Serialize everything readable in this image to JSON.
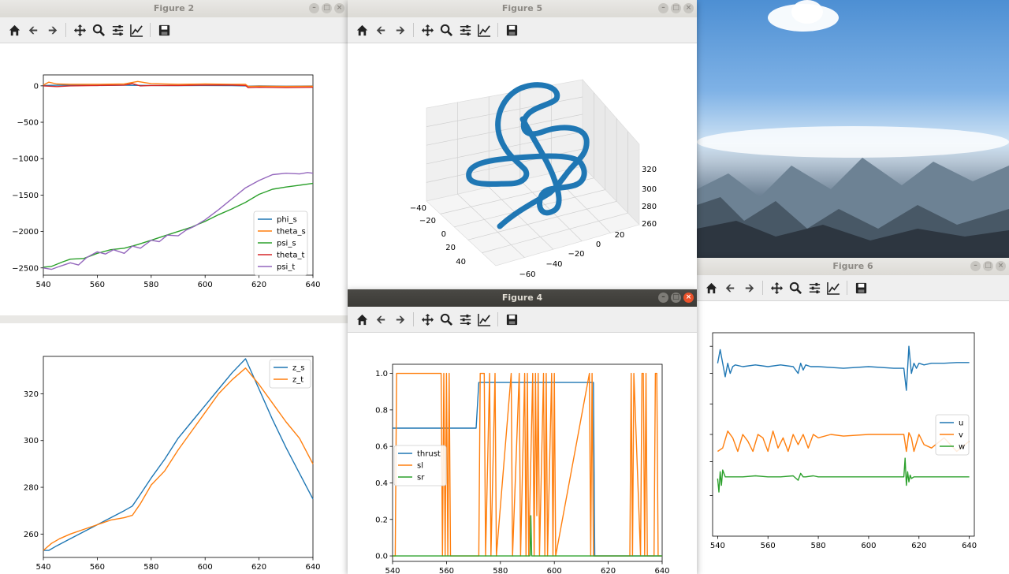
{
  "windows": {
    "fig2": {
      "title": "Figure 2"
    },
    "fig5": {
      "title": "Figure 5"
    },
    "fig4": {
      "title": "Figure 4"
    },
    "fig6": {
      "title": "Figure 6"
    }
  },
  "toolbar_icons": [
    "home-icon",
    "back-icon",
    "forward-icon",
    "pan-icon",
    "zoom-icon",
    "configure-subplots-icon",
    "edit-axis-icon",
    "save-icon"
  ],
  "colors": {
    "c0": "#1f77b4",
    "c1": "#ff7f0e",
    "c2": "#2ca02c",
    "c3": "#d62728",
    "c4": "#9467bd"
  },
  "chart_data": [
    {
      "id": "fig2-angles",
      "type": "line",
      "xlim": [
        540,
        640
      ],
      "ylim": [
        -2600,
        150
      ],
      "xticks": [
        "540",
        "560",
        "580",
        "600",
        "620",
        "640"
      ],
      "yticks": [
        "0",
        "−500",
        "−1000",
        "−1500",
        "−2000",
        "−2500"
      ],
      "legend_position": "lower-right",
      "series": [
        {
          "name": "phi_s",
          "color": "#1f77b4",
          "x": [
            540,
            545,
            550,
            560,
            570,
            580,
            590,
            600,
            610,
            615,
            615.5,
            620,
            630,
            640
          ],
          "y": [
            5,
            8,
            10,
            5,
            8,
            5,
            3,
            5,
            3,
            0,
            -5,
            -2,
            -5,
            -3
          ]
        },
        {
          "name": "theta_s",
          "color": "#ff7f0e",
          "x": [
            540,
            542,
            545,
            550,
            560,
            570,
            575,
            580,
            590,
            600,
            610,
            615,
            616,
            620,
            630,
            640
          ],
          "y": [
            10,
            50,
            25,
            20,
            20,
            25,
            60,
            30,
            20,
            25,
            20,
            20,
            -8,
            -5,
            -8,
            -5
          ]
        },
        {
          "name": "psi_s",
          "color": "#2ca02c",
          "x": [
            540,
            543,
            547,
            550,
            555,
            560,
            565,
            570,
            575,
            580,
            585,
            590,
            595,
            600,
            605,
            610,
            615,
            620,
            625,
            630,
            635,
            640
          ],
          "y": [
            -2490,
            -2480,
            -2420,
            -2380,
            -2370,
            -2300,
            -2250,
            -2230,
            -2180,
            -2120,
            -2060,
            -2000,
            -1940,
            -1860,
            -1770,
            -1690,
            -1600,
            -1490,
            -1420,
            -1390,
            -1365,
            -1340
          ]
        },
        {
          "name": "theta_t",
          "color": "#d62728",
          "x": [
            540,
            545,
            550,
            560,
            570,
            573,
            576,
            580,
            590,
            600,
            610,
            615,
            616,
            620,
            630,
            640
          ],
          "y": [
            0,
            -10,
            0,
            5,
            10,
            30,
            0,
            5,
            5,
            10,
            10,
            5,
            -25,
            -20,
            -25,
            -20
          ]
        },
        {
          "name": "psi_t",
          "color": "#9467bd",
          "x": [
            540,
            543,
            546,
            550,
            553,
            556,
            560,
            563,
            566,
            570,
            573,
            576,
            580,
            583,
            586,
            590,
            593,
            596,
            600,
            605,
            610,
            615,
            620,
            625,
            630,
            635,
            638,
            640
          ],
          "y": [
            -2500,
            -2520,
            -2480,
            -2430,
            -2460,
            -2360,
            -2280,
            -2310,
            -2250,
            -2300,
            -2200,
            -2230,
            -2120,
            -2140,
            -2050,
            -2060,
            -1980,
            -1930,
            -1840,
            -1700,
            -1550,
            -1400,
            -1300,
            -1220,
            -1200,
            -1210,
            -1190,
            -1200
          ]
        }
      ]
    },
    {
      "id": "fig2-z",
      "type": "line",
      "xlim": [
        540,
        640
      ],
      "ylim": [
        250,
        336
      ],
      "xticks": [
        "540",
        "560",
        "580",
        "600",
        "620",
        "640"
      ],
      "yticks": [
        "260",
        "280",
        "300",
        "320"
      ],
      "legend_position": "upper-right",
      "series": [
        {
          "name": "z_s",
          "color": "#1f77b4",
          "x": [
            540,
            542,
            545,
            550,
            555,
            560,
            565,
            570,
            573,
            576,
            580,
            585,
            590,
            595,
            600,
            605,
            610,
            615,
            620,
            625,
            630,
            635,
            640
          ],
          "y": [
            253,
            253,
            255,
            258,
            261,
            264,
            267,
            270,
            272,
            277,
            284,
            292,
            301,
            308,
            315,
            322,
            329,
            335,
            322,
            309,
            297,
            286,
            275
          ]
        },
        {
          "name": "z_t",
          "color": "#ff7f0e",
          "x": [
            540,
            543,
            546,
            550,
            555,
            560,
            565,
            570,
            573,
            576,
            580,
            585,
            590,
            595,
            600,
            605,
            610,
            615,
            620,
            625,
            630,
            635,
            640
          ],
          "y": [
            253,
            256,
            258,
            260,
            262,
            264,
            266,
            267,
            268,
            273,
            281,
            287,
            296,
            304,
            312,
            320,
            326,
            331,
            324,
            316,
            308,
            301,
            290
          ]
        }
      ]
    },
    {
      "id": "fig5-3d",
      "type": "scatter",
      "axis_ticks": {
        "x": [
          "−40",
          "−20",
          "0",
          "20",
          "40"
        ],
        "y": [
          "−60",
          "−40",
          "−20",
          "0",
          "20"
        ],
        "z": [
          "260",
          "280",
          "300",
          "320"
        ]
      },
      "series": [
        {
          "color": "#1f77b4"
        }
      ]
    },
    {
      "id": "fig4-controls",
      "type": "line",
      "xlim": [
        540,
        640
      ],
      "ylim": [
        -0.03,
        1.05
      ],
      "xticks": [
        "540",
        "560",
        "580",
        "600",
        "620",
        "640"
      ],
      "yticks": [
        "0.0",
        "0.2",
        "0.4",
        "0.6",
        "0.8",
        "1.0"
      ],
      "legend_position": "center-left",
      "series": [
        {
          "name": "thrust",
          "color": "#1f77b4",
          "x": [
            540,
            571,
            572,
            614.5,
            615,
            640
          ],
          "y": [
            0.7,
            0.7,
            0.95,
            0.95,
            0,
            0
          ]
        },
        {
          "name": "sl",
          "color": "#ff7f0e",
          "x": [
            540,
            541,
            541.5,
            558,
            558.5,
            559,
            559.5,
            560,
            560.5,
            561,
            561.5,
            572,
            572.5,
            574,
            574.5,
            576,
            576.5,
            578,
            578.5,
            584,
            584.5,
            587,
            587.5,
            589,
            589.5,
            590,
            590.5,
            592,
            592.5,
            593,
            593.5,
            594,
            594.5,
            596,
            596.5,
            597,
            597.5,
            599,
            599.5,
            600,
            600.5,
            613,
            613.5,
            614,
            614.5,
            628,
            628.5,
            629,
            629.5,
            632,
            632.5,
            633,
            633.5,
            634,
            634.5,
            637,
            637.5,
            638,
            638.5,
            640
          ],
          "y": [
            0,
            0,
            1,
            1,
            0,
            1,
            0,
            1,
            0,
            1,
            0,
            0,
            1,
            1,
            0,
            1,
            0,
            1,
            0,
            1,
            0,
            1,
            0,
            1,
            0,
            1,
            0,
            1,
            0,
            1,
            0.22,
            1,
            0,
            1,
            0,
            1,
            0,
            1,
            0,
            1,
            0,
            1,
            0,
            1,
            0,
            0,
            1,
            0,
            1,
            0,
            1,
            1,
            0,
            1,
            0,
            0,
            1,
            1,
            0,
            0
          ]
        },
        {
          "name": "sr",
          "color": "#2ca02c",
          "x": [
            540,
            591,
            591.3,
            591.6,
            592,
            640
          ],
          "y": [
            0,
            0,
            0.22,
            0.0,
            0,
            0
          ]
        }
      ]
    },
    {
      "id": "fig6-velocities",
      "type": "line",
      "xlim": [
        538,
        642
      ],
      "ylim": [
        -4.5,
        1.5
      ],
      "xticks": [
        "540",
        "560",
        "580",
        "600",
        "620",
        "640"
      ],
      "legend_position": "center-right",
      "series": [
        {
          "name": "u",
          "color": "#1f77b4",
          "x": [
            540,
            541,
            542,
            543,
            544,
            545,
            546,
            547,
            550,
            555,
            560,
            565,
            570,
            572,
            573,
            574,
            575,
            577,
            580,
            590,
            600,
            610,
            614,
            615,
            616,
            617,
            618,
            619,
            620,
            622,
            625,
            630,
            635,
            640
          ],
          "y": [
            0.6,
            1.0,
            0.6,
            0.2,
            0.6,
            0.3,
            0.5,
            0.55,
            0.5,
            0.55,
            0.5,
            0.55,
            0.5,
            0.3,
            0.6,
            0.4,
            0.55,
            0.5,
            0.5,
            0.45,
            0.5,
            0.45,
            0.45,
            -0.2,
            1.1,
            0.3,
            0.6,
            0.45,
            0.6,
            0.55,
            0.6,
            0.6,
            0.62,
            0.62
          ]
        },
        {
          "name": "v",
          "color": "#ff7f0e",
          "x": [
            540,
            542,
            544,
            546,
            548,
            550,
            552,
            554,
            556,
            558,
            560,
            562,
            564,
            566,
            568,
            570,
            572,
            574,
            576,
            578,
            580,
            585,
            590,
            600,
            610,
            614,
            615,
            616,
            617,
            618,
            620,
            622,
            625,
            630,
            635,
            640
          ],
          "y": [
            -2.0,
            -1.9,
            -1.4,
            -1.6,
            -2.0,
            -1.5,
            -1.7,
            -2.0,
            -1.5,
            -1.6,
            -2.0,
            -1.4,
            -1.9,
            -1.6,
            -2.0,
            -1.5,
            -1.8,
            -1.5,
            -1.9,
            -1.5,
            -1.6,
            -1.5,
            -1.55,
            -1.5,
            -1.5,
            -1.5,
            -2.0,
            -1.45,
            -1.6,
            -2.0,
            -1.5,
            -1.8,
            -1.9,
            -1.6,
            -2.0,
            -1.7
          ]
        },
        {
          "name": "w",
          "color": "#2ca02c",
          "x": [
            540,
            540.5,
            541,
            541.5,
            542,
            543,
            545,
            550,
            555,
            560,
            565,
            570,
            572,
            573,
            574,
            575,
            578,
            580,
            590,
            600,
            610,
            614,
            614.5,
            615,
            615.5,
            616,
            616.5,
            617,
            618,
            620,
            625,
            630,
            640
          ],
          "y": [
            -2.8,
            -3.2,
            -2.6,
            -3.0,
            -2.55,
            -2.75,
            -2.75,
            -2.75,
            -2.72,
            -2.75,
            -2.75,
            -2.72,
            -2.85,
            -2.65,
            -2.75,
            -2.75,
            -2.72,
            -2.75,
            -2.75,
            -2.75,
            -2.75,
            -2.75,
            -2.2,
            -3.0,
            -2.6,
            -2.9,
            -2.7,
            -2.8,
            -2.75,
            -2.75,
            -2.75,
            -2.75,
            -2.75
          ]
        }
      ]
    }
  ]
}
